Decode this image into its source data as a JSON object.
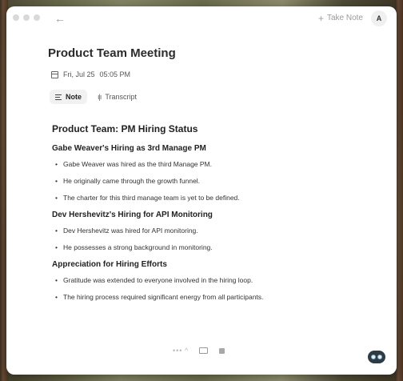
{
  "toolbar": {
    "back_icon": "arrow-left-icon",
    "take_note_label": "Take Note",
    "avatar_initial": "A"
  },
  "meeting": {
    "title": "Product Team Meeting",
    "date": "Fri, Jul 25",
    "time": "05:05 PM"
  },
  "tabs": [
    {
      "label": "Note",
      "icon": "lines-icon",
      "active": true
    },
    {
      "label": "Transcript",
      "icon": "waveform-icon",
      "active": false
    }
  ],
  "note": {
    "title": "Product Team: PM Hiring Status",
    "sections": [
      {
        "heading": "Gabe Weaver's Hiring as 3rd Manage PM",
        "bullets": [
          "Gabe Weaver was hired as the third Manage PM.",
          "He originally came through the growth funnel.",
          "The charter for this third manage team is yet to be defined."
        ]
      },
      {
        "heading": "Dev Hershevitz's Hiring for API Monitoring",
        "bullets": [
          "Dev Hershevitz was hired for API monitoring.",
          "He possesses a strong background in monitoring."
        ]
      },
      {
        "heading": "Appreciation for Hiring Efforts",
        "bullets": [
          "Gratitude was extended to everyone involved in the hiring loop.",
          "The hiring process required significant energy from all participants."
        ]
      }
    ]
  },
  "bottom_bar": {
    "more_label": "•••",
    "chevron": "^"
  }
}
